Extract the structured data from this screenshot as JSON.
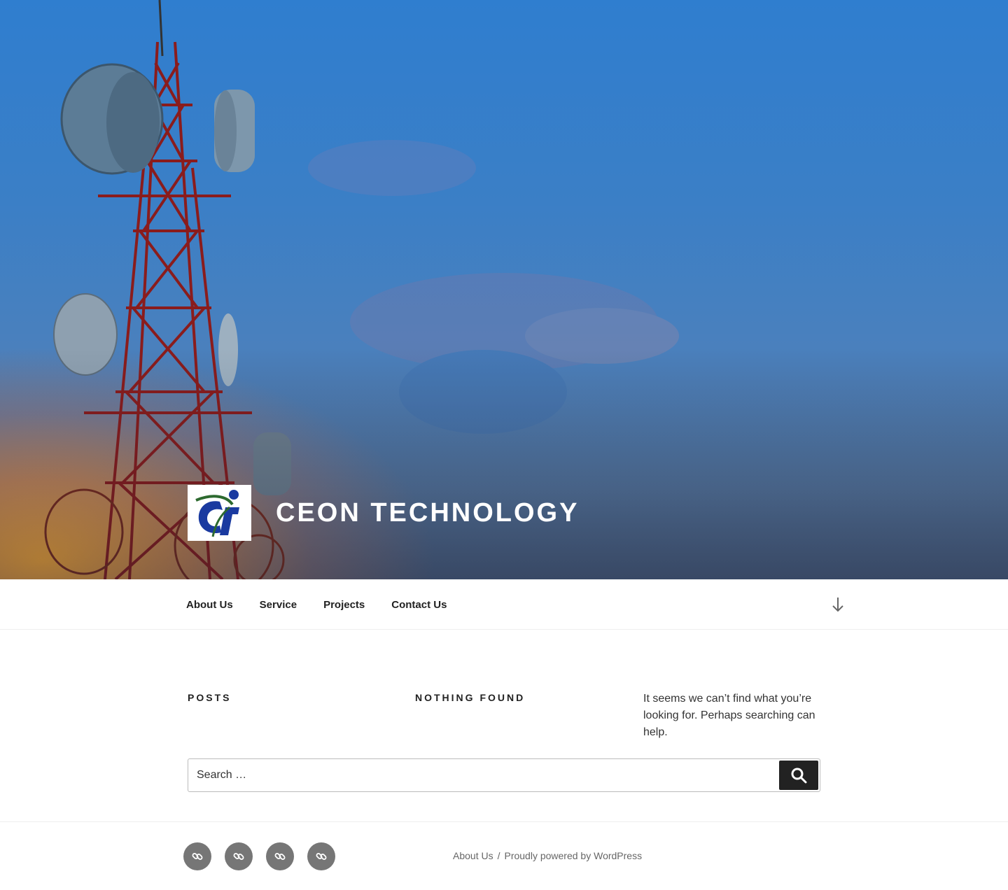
{
  "site": {
    "title": "CEON TECHNOLOGY",
    "logo_icon": "ct-logo-icon"
  },
  "nav": {
    "items": [
      {
        "label": "About Us"
      },
      {
        "label": "Service"
      },
      {
        "label": "Projects"
      },
      {
        "label": "Contact Us"
      }
    ],
    "scroll_icon": "arrow-down-icon"
  },
  "content": {
    "posts_heading": "Posts",
    "nothing_heading": "Nothing Found",
    "message": "It seems we can’t find what you’re looking for. Perhaps searching can help.",
    "search": {
      "placeholder": "Search …",
      "button_icon": "search-icon"
    }
  },
  "footer": {
    "social_icons": [
      "link-icon",
      "link-icon",
      "link-icon",
      "link-icon"
    ],
    "about_link": "About Us",
    "separator": "/",
    "powered_by": "Proudly powered by WordPress"
  },
  "colors": {
    "accent_dark": "#222222",
    "social_bg": "#767676",
    "logo_blue": "#1a3aa0",
    "logo_green": "#2d6a2f"
  }
}
